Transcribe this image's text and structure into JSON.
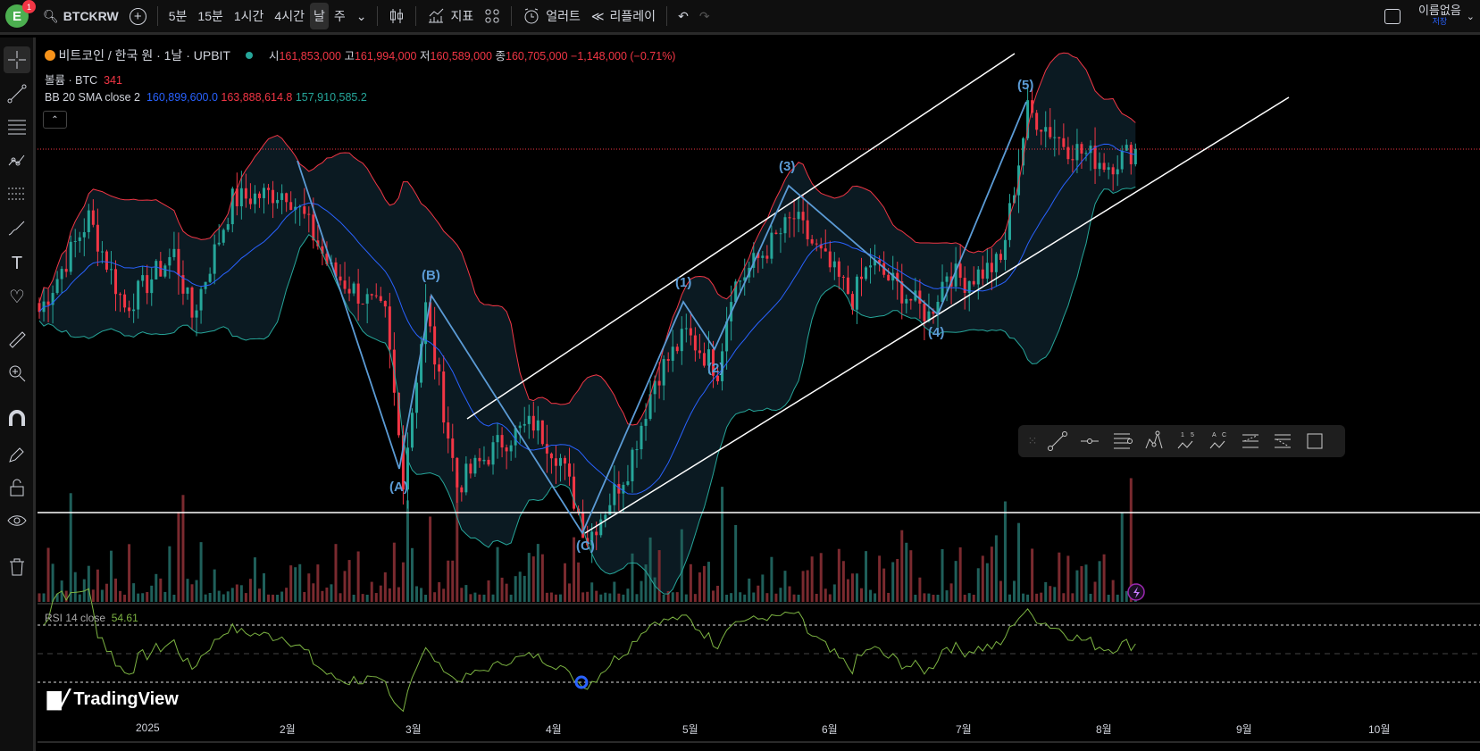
{
  "topbar": {
    "avatar_letter": "E",
    "notif_count": "1",
    "symbol": "BTCKRW",
    "intervals": [
      "5분",
      "15분",
      "1시간",
      "4시간",
      "날",
      "주"
    ],
    "active_interval": "날",
    "indicators_label": "지표",
    "alert_label": "얼러트",
    "replay_label": "리플레이",
    "layout_name": "이름없음",
    "save_label": "저장"
  },
  "legend": {
    "title": "비트코인 / 한국 원 · 1날 · UPBIT",
    "o_label": "시",
    "o": "161,853,000",
    "h_label": "고",
    "h": "161,994,000",
    "l_label": "저",
    "l": "160,589,000",
    "c_label": "종",
    "c": "160,705,000",
    "change": "−1,148,000 (−0.71%)",
    "volume_label": "볼륨 · BTC",
    "volume": "341",
    "bb_label": "BB 20 SMA close 2",
    "bb_basis": "160,899,600.0",
    "bb_upper": "163,888,614.8",
    "bb_lower": "157,910,585.2"
  },
  "rsi": {
    "label": "RSI 14 close",
    "value": "54.61"
  },
  "wave_labels": [
    "(A)",
    "(B)",
    "(C)",
    "(1)",
    "(2)",
    "(3)",
    "(4)",
    "(5)"
  ],
  "time_axis": [
    "2025",
    "2월",
    "3월",
    "4월",
    "5월",
    "6월",
    "7월",
    "8월",
    "9월",
    "10월"
  ],
  "watermark": "TradingView",
  "colors": {
    "up": "#26a69a",
    "down": "#f23645",
    "bb_basis": "#2962ff",
    "bb_upper": "#f23645",
    "bb_lower": "#26a69a",
    "rsi": "#7cb342",
    "wave": "#5b9bd5"
  },
  "price_anchors_million_krw": [
    [
      0,
      142.5
    ],
    [
      11,
      153
    ],
    [
      19,
      143
    ],
    [
      30,
      149
    ],
    [
      34,
      142
    ],
    [
      43,
      155
    ],
    [
      55,
      156
    ],
    [
      59,
      153
    ],
    [
      65,
      147
    ],
    [
      77,
      142
    ],
    [
      81,
      124
    ],
    [
      86,
      143
    ],
    [
      93,
      123
    ],
    [
      103,
      128
    ],
    [
      110,
      130
    ],
    [
      116,
      126
    ],
    [
      122,
      117
    ],
    [
      131,
      125
    ],
    [
      137,
      135
    ],
    [
      144,
      140
    ],
    [
      151,
      136
    ],
    [
      154,
      145
    ],
    [
      168,
      153
    ],
    [
      175,
      148
    ],
    [
      181,
      144
    ],
    [
      185,
      148
    ],
    [
      198,
      142
    ],
    [
      202,
      147
    ],
    [
      206,
      146
    ],
    [
      214,
      148
    ],
    [
      220,
      165
    ],
    [
      229,
      161
    ],
    [
      238,
      159
    ],
    [
      244,
      160.7
    ]
  ]
}
